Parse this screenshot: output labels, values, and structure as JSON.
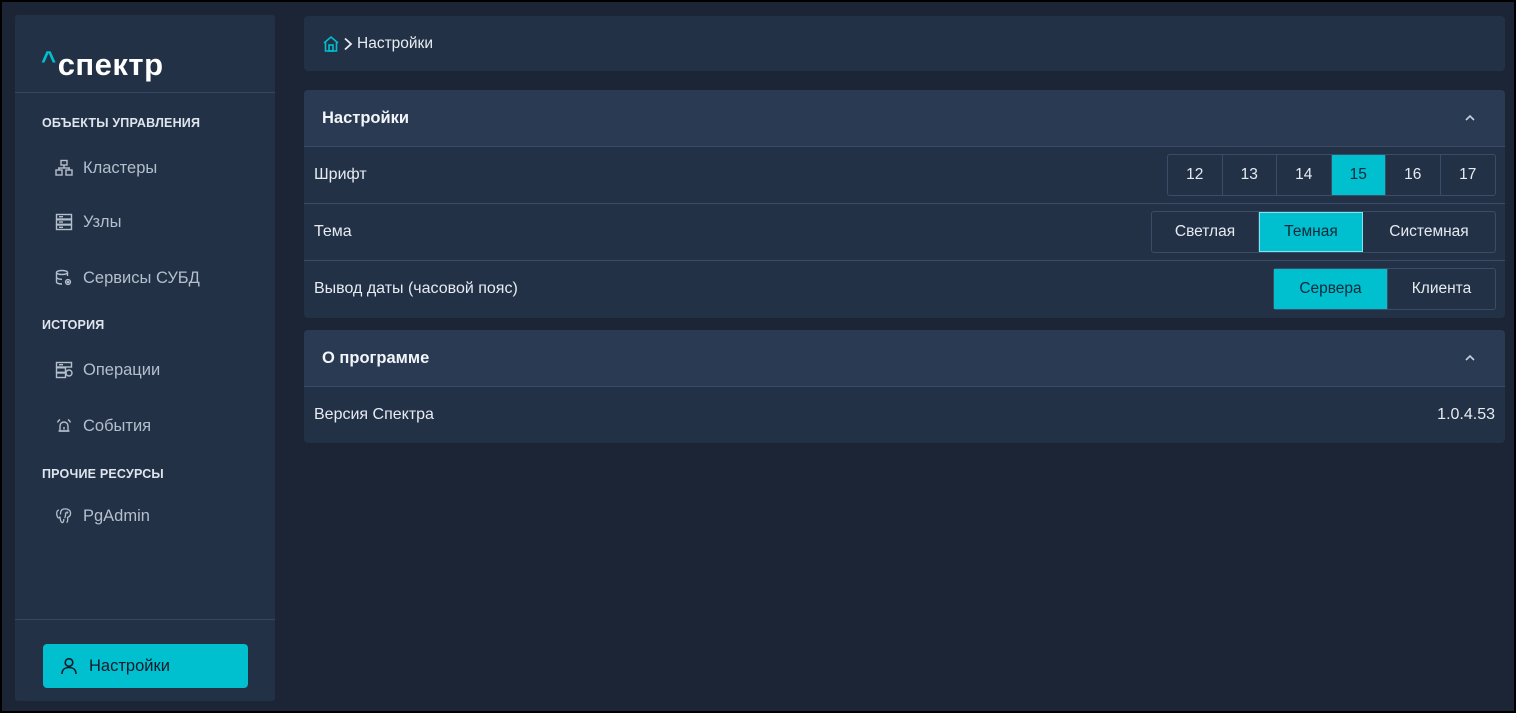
{
  "app": {
    "logo_caret": "^",
    "logo_text": "спектр"
  },
  "sidebar": {
    "sections": [
      {
        "title": "ОБЪЕКТЫ УПРАВЛЕНИЯ",
        "items": [
          {
            "label": "Кластеры",
            "icon": "cluster-icon"
          },
          {
            "label": "Узлы",
            "icon": "server-icon"
          },
          {
            "label": "Сервисы СУБД",
            "icon": "database-gear-icon"
          }
        ]
      },
      {
        "title": "ИСТОРИЯ",
        "items": [
          {
            "label": "Операции",
            "icon": "operations-icon"
          },
          {
            "label": "События",
            "icon": "alarm-icon"
          }
        ]
      },
      {
        "title": "ПРОЧИЕ РЕСУРСЫ",
        "items": [
          {
            "label": "PgAdmin",
            "icon": "postgres-elephant-icon"
          }
        ]
      }
    ],
    "settings_button": {
      "label": "Настройки",
      "icon": "user-icon"
    }
  },
  "breadcrumb": {
    "home_icon": "home-icon",
    "separator_icon": "chevron-right-icon",
    "current": "Настройки"
  },
  "settings_panel": {
    "title": "Настройки",
    "font_row": {
      "label": "Шрифт",
      "options": [
        "12",
        "13",
        "14",
        "15",
        "16",
        "17"
      ],
      "selected": "15"
    },
    "theme_row": {
      "label": "Тема",
      "options": [
        "Светлая",
        "Темная",
        "Системная"
      ],
      "selected": "Темная"
    },
    "date_row": {
      "label": "Вывод даты (часовой пояс)",
      "options": [
        "Сервера",
        "Клиента"
      ],
      "selected": "Сервера"
    }
  },
  "about_panel": {
    "title": "О программе",
    "version_label": "Версия Спектра",
    "version_value": "1.0.4.53"
  },
  "colors": {
    "accent": "#00bfcf",
    "background": "#1b2535",
    "panel": "#233146",
    "panel_header": "#2a3a52"
  }
}
